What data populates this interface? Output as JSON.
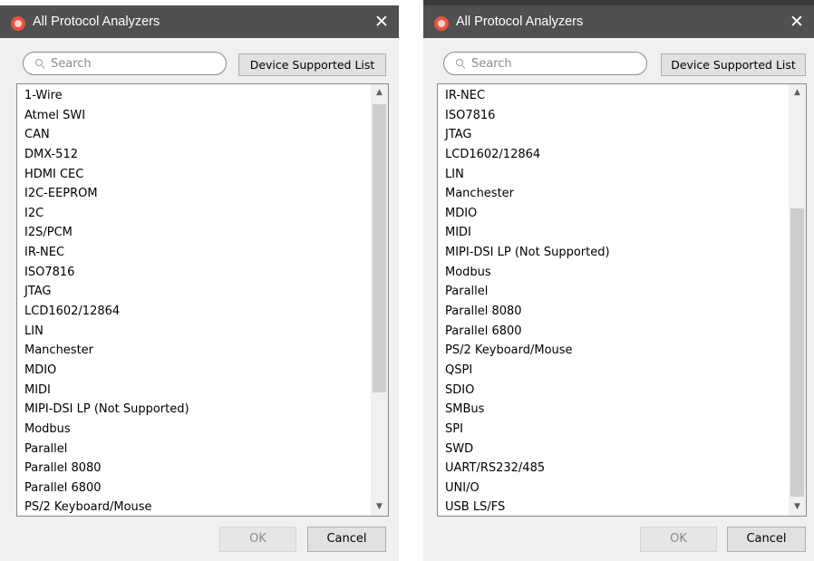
{
  "left_dialog": {
    "title": "All Protocol Analyzers",
    "close_glyph": "✕",
    "search": {
      "placeholder": "Search",
      "value": ""
    },
    "device_supported_list_label": "Device Supported List",
    "items": [
      "1-Wire",
      "Atmel SWI",
      "CAN",
      "DMX-512",
      "HDMI CEC",
      "I2C-EEPROM",
      "I2C",
      "I2S/PCM",
      "IR-NEC",
      "ISO7816",
      "JTAG",
      "LCD1602/12864",
      "LIN",
      "Manchester",
      "MDIO",
      "MIDI",
      "MIPI-DSI LP (Not Supported)",
      "Modbus",
      "Parallel",
      "Parallel 8080",
      "Parallel 6800",
      "PS/2 Keyboard/Mouse"
    ],
    "scroll_up_glyph": "▲",
    "scroll_down_glyph": "▼",
    "ok_label": "OK",
    "cancel_label": "Cancel"
  },
  "right_dialog": {
    "title": "All Protocol Analyzers",
    "close_glyph": "✕",
    "search": {
      "placeholder": "Search",
      "value": ""
    },
    "device_supported_list_label": "Device Supported List",
    "items": [
      "IR-NEC",
      "ISO7816",
      "JTAG",
      "LCD1602/12864",
      "LIN",
      "Manchester",
      "MDIO",
      "MIDI",
      "MIPI-DSI LP (Not Supported)",
      "Modbus",
      "Parallel",
      "Parallel 8080",
      "Parallel 6800",
      "PS/2 Keyboard/Mouse",
      "QSPI",
      "SDIO",
      "SMBus",
      "SPI",
      "SWD",
      "UART/RS232/485",
      "UNI/O",
      "USB LS/FS"
    ],
    "scroll_up_glyph": "▲",
    "scroll_down_glyph": "▼",
    "ok_label": "OK",
    "cancel_label": "Cancel"
  },
  "colors": {
    "titlebar": "#505050",
    "app_icon": "#e8543f",
    "dialog_bg": "#f0f0f0",
    "scroll_thumb": "#cdcdcd"
  }
}
